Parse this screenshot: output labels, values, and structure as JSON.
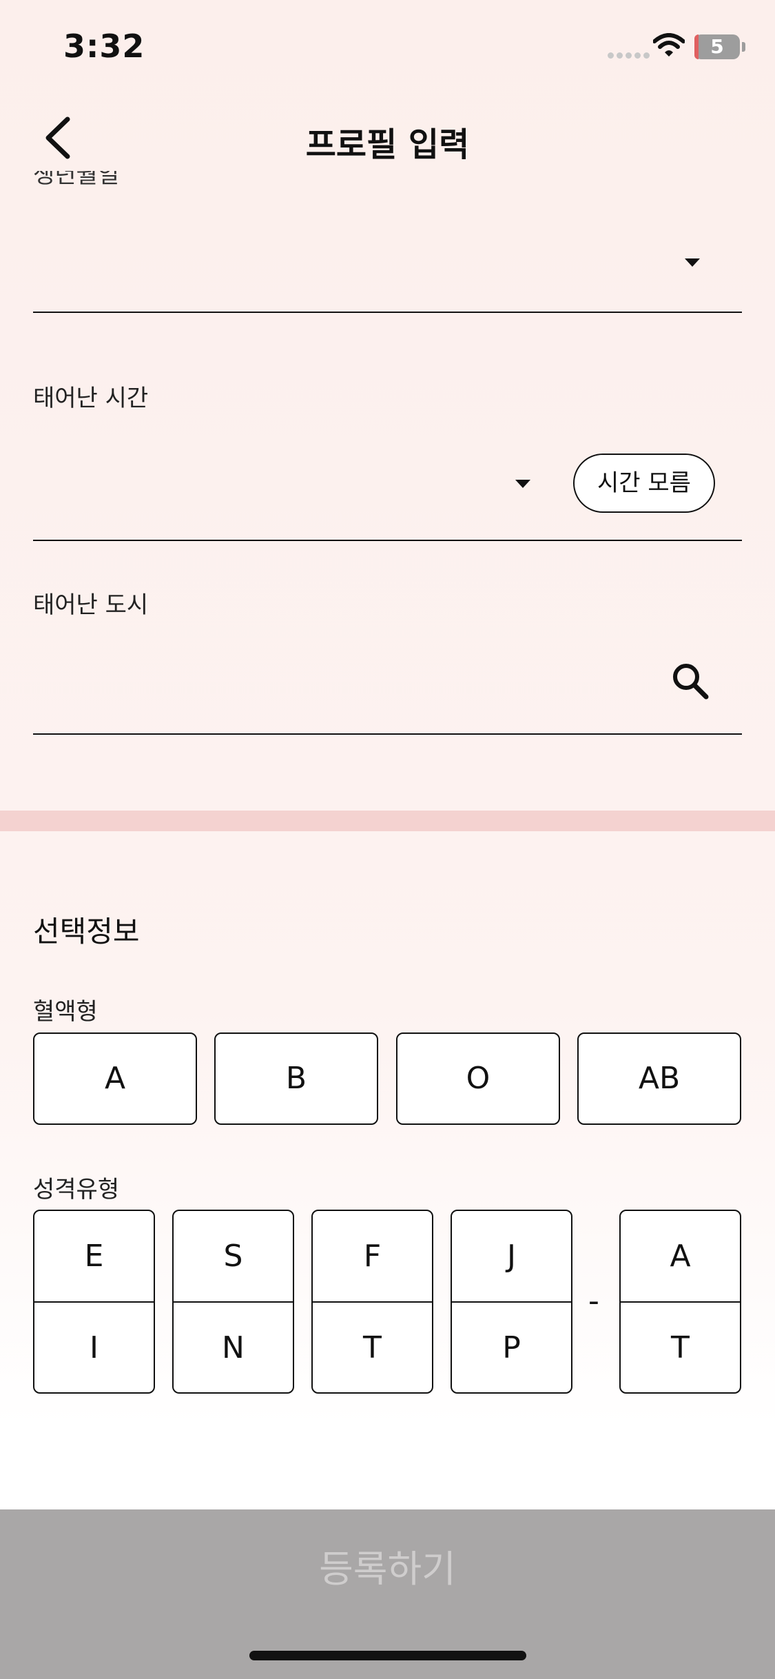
{
  "status_bar": {
    "time": "3:32",
    "battery": "5"
  },
  "header": {
    "title": "프로필 입력"
  },
  "form": {
    "clipped_label": "생년월일",
    "birth_time_label": "태어난 시간",
    "time_unknown_label": "시간 모름",
    "birth_city_label": "태어난 도시"
  },
  "optional": {
    "section_title": "선택정보",
    "blood_type_label": "혈액형",
    "blood_types": [
      "A",
      "B",
      "O",
      "AB"
    ],
    "personality_label": "성격유형",
    "mbti_pairs": [
      {
        "top": "E",
        "bottom": "I"
      },
      {
        "top": "S",
        "bottom": "N"
      },
      {
        "top": "F",
        "bottom": "T"
      },
      {
        "top": "J",
        "bottom": "P"
      }
    ],
    "separator": "-",
    "identity_pair": {
      "top": "A",
      "bottom": "T"
    }
  },
  "footer": {
    "register_label": "등록하기"
  },
  "colors": {
    "divider": "#f4d2d0",
    "button_disabled": "#a9a7a7"
  }
}
